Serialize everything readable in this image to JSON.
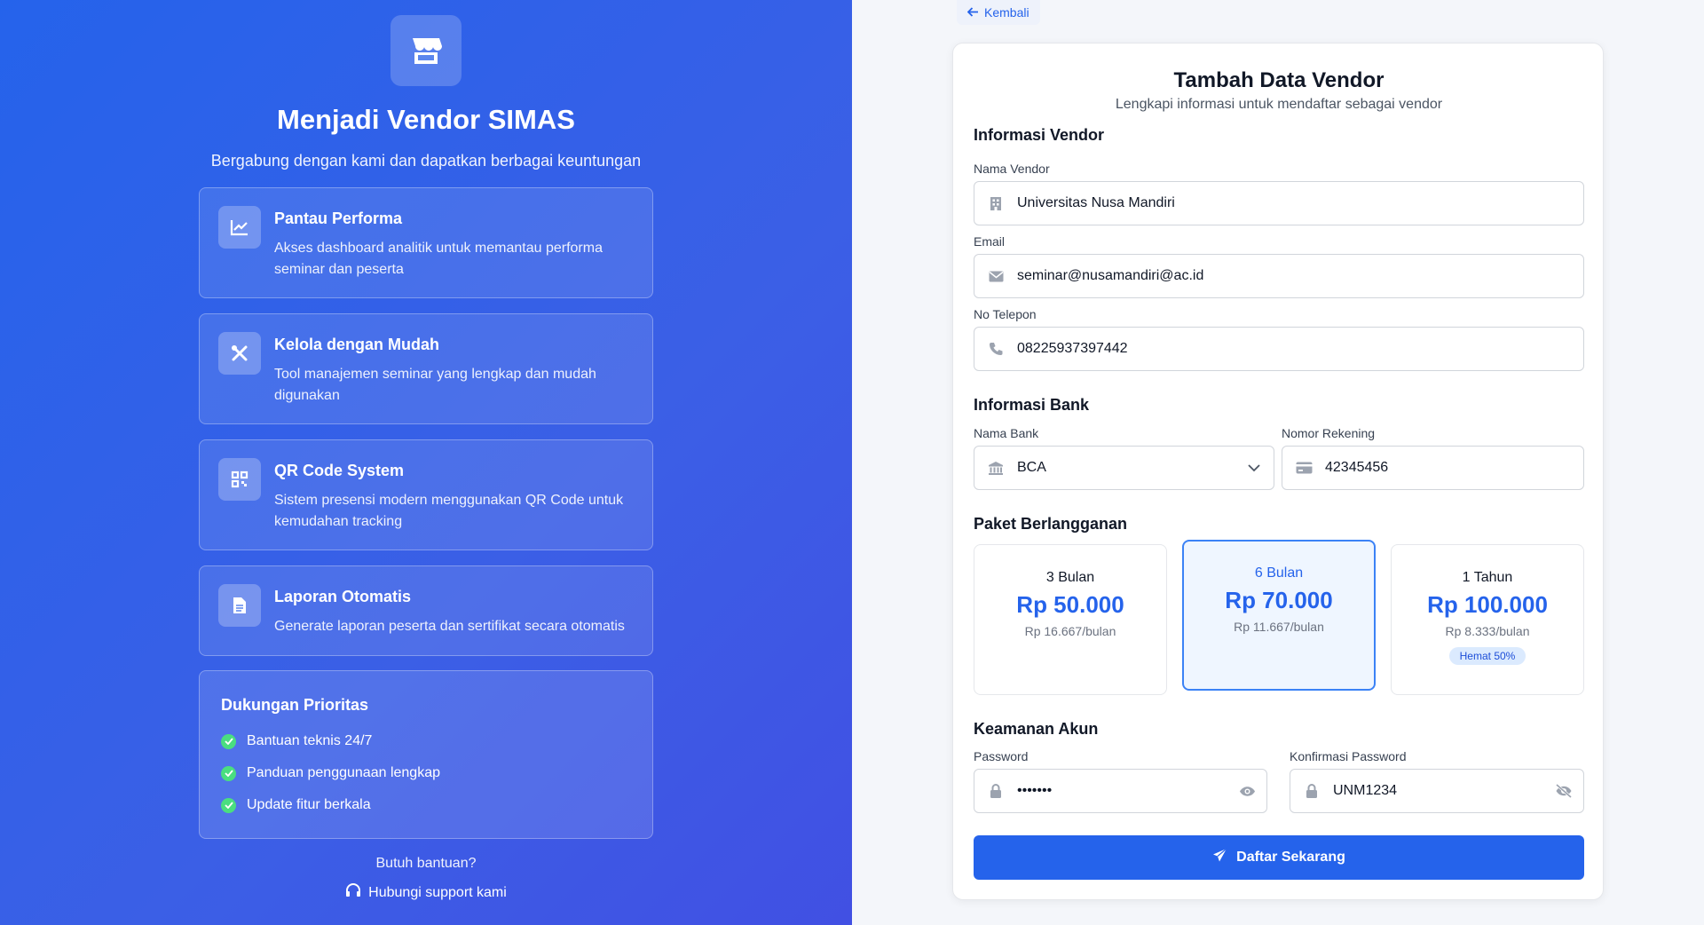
{
  "left": {
    "title": "Menjadi Vendor SIMAS",
    "subtitle": "Bergabung dengan kami dan dapatkan berbagai keuntungan",
    "features": [
      {
        "title": "Pantau Performa",
        "desc": "Akses dashboard analitik untuk memantau performa seminar dan peserta",
        "icon": "chart-line-icon"
      },
      {
        "title": "Kelola dengan Mudah",
        "desc": "Tool manajemen seminar yang lengkap dan mudah digunakan",
        "icon": "tools-icon"
      },
      {
        "title": "QR Code System",
        "desc": "Sistem presensi modern menggunakan QR Code untuk kemudahan tracking",
        "icon": "qrcode-icon"
      },
      {
        "title": "Laporan Otomatis",
        "desc": "Generate laporan peserta dan sertifikat secara otomatis",
        "icon": "document-icon"
      }
    ],
    "support": {
      "title": "Dukungan Prioritas",
      "items": [
        "Bantuan teknis 24/7",
        "Panduan penggunaan lengkap",
        "Update fitur berkala"
      ]
    },
    "help_question": "Butuh bantuan?",
    "help_link": "Hubungi support kami"
  },
  "right": {
    "back_label": "Kembali",
    "title": "Tambah Data Vendor",
    "subtitle": "Lengkapi informasi untuk mendaftar sebagai vendor",
    "vendor_section": "Informasi Vendor",
    "vendor_name_label": "Nama Vendor",
    "vendor_name_value": "Universitas Nusa Mandiri",
    "email_label": "Email",
    "email_value": "seminar@nusamandiri@ac.id",
    "phone_label": "No Telepon",
    "phone_value": "08225937397442",
    "bank_section": "Informasi Bank",
    "bank_name_label": "Nama Bank",
    "bank_name_value": "BCA",
    "account_label": "Nomor Rekening",
    "account_value": "42345456",
    "plan_section": "Paket Berlangganan",
    "plans": [
      {
        "name": "3 Bulan",
        "price": "Rp 50.000",
        "monthly": "Rp 16.667/bulan",
        "badge": ""
      },
      {
        "name": "6 Bulan",
        "price": "Rp 70.000",
        "monthly": "Rp 11.667/bulan",
        "badge": ""
      },
      {
        "name": "1 Tahun",
        "price": "Rp 100.000",
        "monthly": "Rp 8.333/bulan",
        "badge": "Hemat 50%"
      }
    ],
    "selected_plan": "6 Bulan",
    "security_section": "Keamanan Akun",
    "password_label": "Password",
    "password_value": "•••••••",
    "confirm_label": "Konfirmasi Password",
    "confirm_value": "UNM1234",
    "submit_label": "Daftar Sekarang"
  },
  "colors": {
    "accent": "#2563eb",
    "check": "#4ade80"
  }
}
